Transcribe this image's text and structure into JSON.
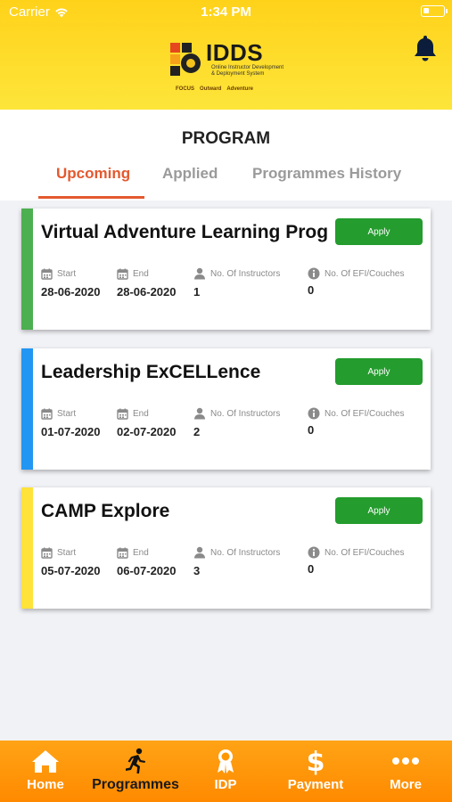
{
  "status_bar": {
    "carrier": "Carrier",
    "time": "1:34 PM"
  },
  "logo": {
    "title": "IDDS",
    "subtitle_line1": "Online Instructor Development",
    "subtitle_line2": "& Deployment System",
    "partners": [
      "FOCUS",
      "Outward",
      "Adventure"
    ]
  },
  "page": {
    "title": "PROGRAM"
  },
  "tabs": [
    {
      "label": "Upcoming"
    },
    {
      "label": "Applied"
    },
    {
      "label": "Programmes History"
    }
  ],
  "stat_labels": {
    "start": "Start",
    "end": "End",
    "instructors": "No. Of Instructors",
    "efi": "No. Of EFI/Couches"
  },
  "programs": [
    {
      "title": "Virtual Adventure Learning Prog",
      "apply_label": "Apply",
      "start": "28-06-2020",
      "end": "28-06-2020",
      "instructors": "1",
      "efi": "0",
      "accent": "#4caf50"
    },
    {
      "title": "Leadership ExCELLence",
      "apply_label": "Apply",
      "start": "01-07-2020",
      "end": "02-07-2020",
      "instructors": "2",
      "efi": "0",
      "accent": "#2196f3"
    },
    {
      "title": "CAMP Explore",
      "apply_label": "Apply",
      "start": "05-07-2020",
      "end": "06-07-2020",
      "instructors": "3",
      "efi": "0",
      "accent": "#ffe23a"
    }
  ],
  "bottom_nav": [
    {
      "label": "Home",
      "icon": "home-icon"
    },
    {
      "label": "Programmes",
      "icon": "running-person-icon"
    },
    {
      "label": "IDP",
      "icon": "award-ribbon-icon"
    },
    {
      "label": "Payment",
      "icon": "dollar-icon"
    },
    {
      "label": "More",
      "icon": "more-dots-icon"
    }
  ],
  "colors": {
    "header_yellow": "#ffd21a",
    "tab_active": "#e3592f",
    "apply_green": "#249c2e",
    "tabbar_orange": "#ff9800"
  }
}
